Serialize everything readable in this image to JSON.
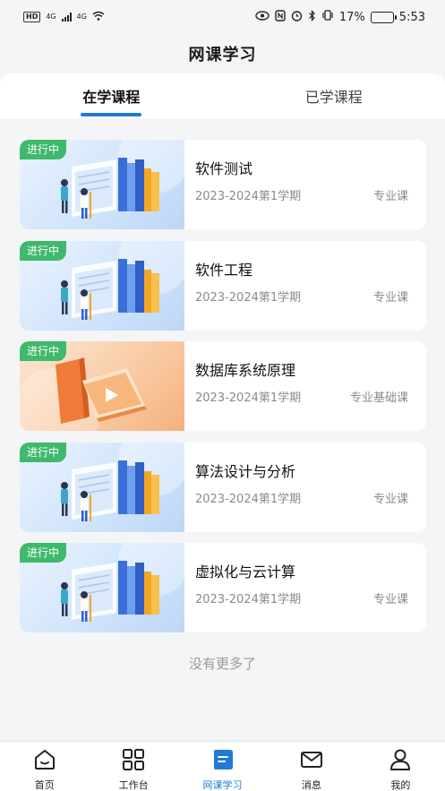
{
  "status_bar": {
    "hd": "HD",
    "net1": "4G",
    "net2": "4G",
    "battery_percent": "17%",
    "battery_level": 0.17,
    "time": "5:53"
  },
  "header": {
    "title": "网课学习"
  },
  "tabs": [
    {
      "label": "在学课程",
      "active": true
    },
    {
      "label": "已学课程",
      "active": false
    }
  ],
  "courses": [
    {
      "badge": "进行中",
      "title": "软件测试",
      "term": "2023-2024第1学期",
      "type": "专业课",
      "thumb": "books-study-blue"
    },
    {
      "badge": "进行中",
      "title": "软件工程",
      "term": "2023-2024第1学期",
      "type": "专业课",
      "thumb": "books-study-blue"
    },
    {
      "badge": "进行中",
      "title": "数据库系统原理",
      "term": "2023-2024第1学期",
      "type": "专业基础课",
      "thumb": "video-book-orange"
    },
    {
      "badge": "进行中",
      "title": "算法设计与分析",
      "term": "2023-2024第1学期",
      "type": "专业课",
      "thumb": "books-study-blue"
    },
    {
      "badge": "进行中",
      "title": "虚拟化与云计算",
      "term": "2023-2024第1学期",
      "type": "专业课",
      "thumb": "books-study-blue"
    }
  ],
  "footer_text": "没有更多了",
  "tabbar": {
    "items": [
      {
        "label": "首页",
        "icon": "home-icon",
        "active": false
      },
      {
        "label": "工作台",
        "icon": "grid-icon",
        "active": false
      },
      {
        "label": "网课学习",
        "icon": "book-icon",
        "active": true
      },
      {
        "label": "消息",
        "icon": "mail-icon",
        "active": false
      },
      {
        "label": "我的",
        "icon": "user-icon",
        "active": false
      }
    ]
  },
  "colors": {
    "accent": "#1f7ad9",
    "badge": "#3fb96b",
    "background": "#f4f5f7"
  }
}
